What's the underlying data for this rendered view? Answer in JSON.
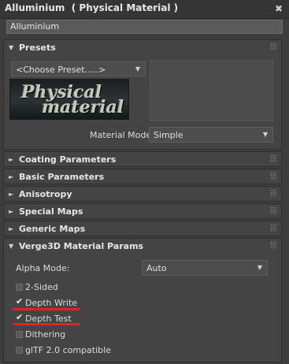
{
  "window": {
    "title": "Alluminium  ( Physical Material )",
    "close_glyph": "✖"
  },
  "material_name": "Alluminium",
  "presets": {
    "label": "Presets",
    "preset_dropdown_value": "<Choose Preset.....>",
    "logo_text": [
      "Physical",
      "material"
    ],
    "material_mode_label": "Material Mode:",
    "material_mode_value": "Simple"
  },
  "collapsed_rollouts": [
    {
      "label": "Coating Parameters"
    },
    {
      "label": "Basic Parameters"
    },
    {
      "label": "Anisotropy"
    },
    {
      "label": "Special Maps"
    },
    {
      "label": "Generic Maps"
    }
  ],
  "verge3d": {
    "label": "Verge3D Material Params",
    "alpha_mode_label": "Alpha Mode:",
    "alpha_mode_value": "Auto",
    "options": [
      {
        "label": "2-Sided",
        "checked": false
      },
      {
        "label": "Depth Write",
        "checked": true
      },
      {
        "label": "Depth Test",
        "checked": true
      },
      {
        "label": "Dithering",
        "checked": false
      },
      {
        "label": "glTF 2.0 compatible",
        "checked": false
      }
    ]
  },
  "icons": {
    "rollout_expanded": "triangle-down-icon",
    "rollout_collapsed": "triangle-right-icon",
    "dropdown": "chevron-down-icon",
    "check": "checkmark-icon"
  },
  "colors": {
    "panel_bg": "#3e3e3e",
    "rollout_bg": "#444444",
    "highlight_underline": "#e0202a"
  }
}
